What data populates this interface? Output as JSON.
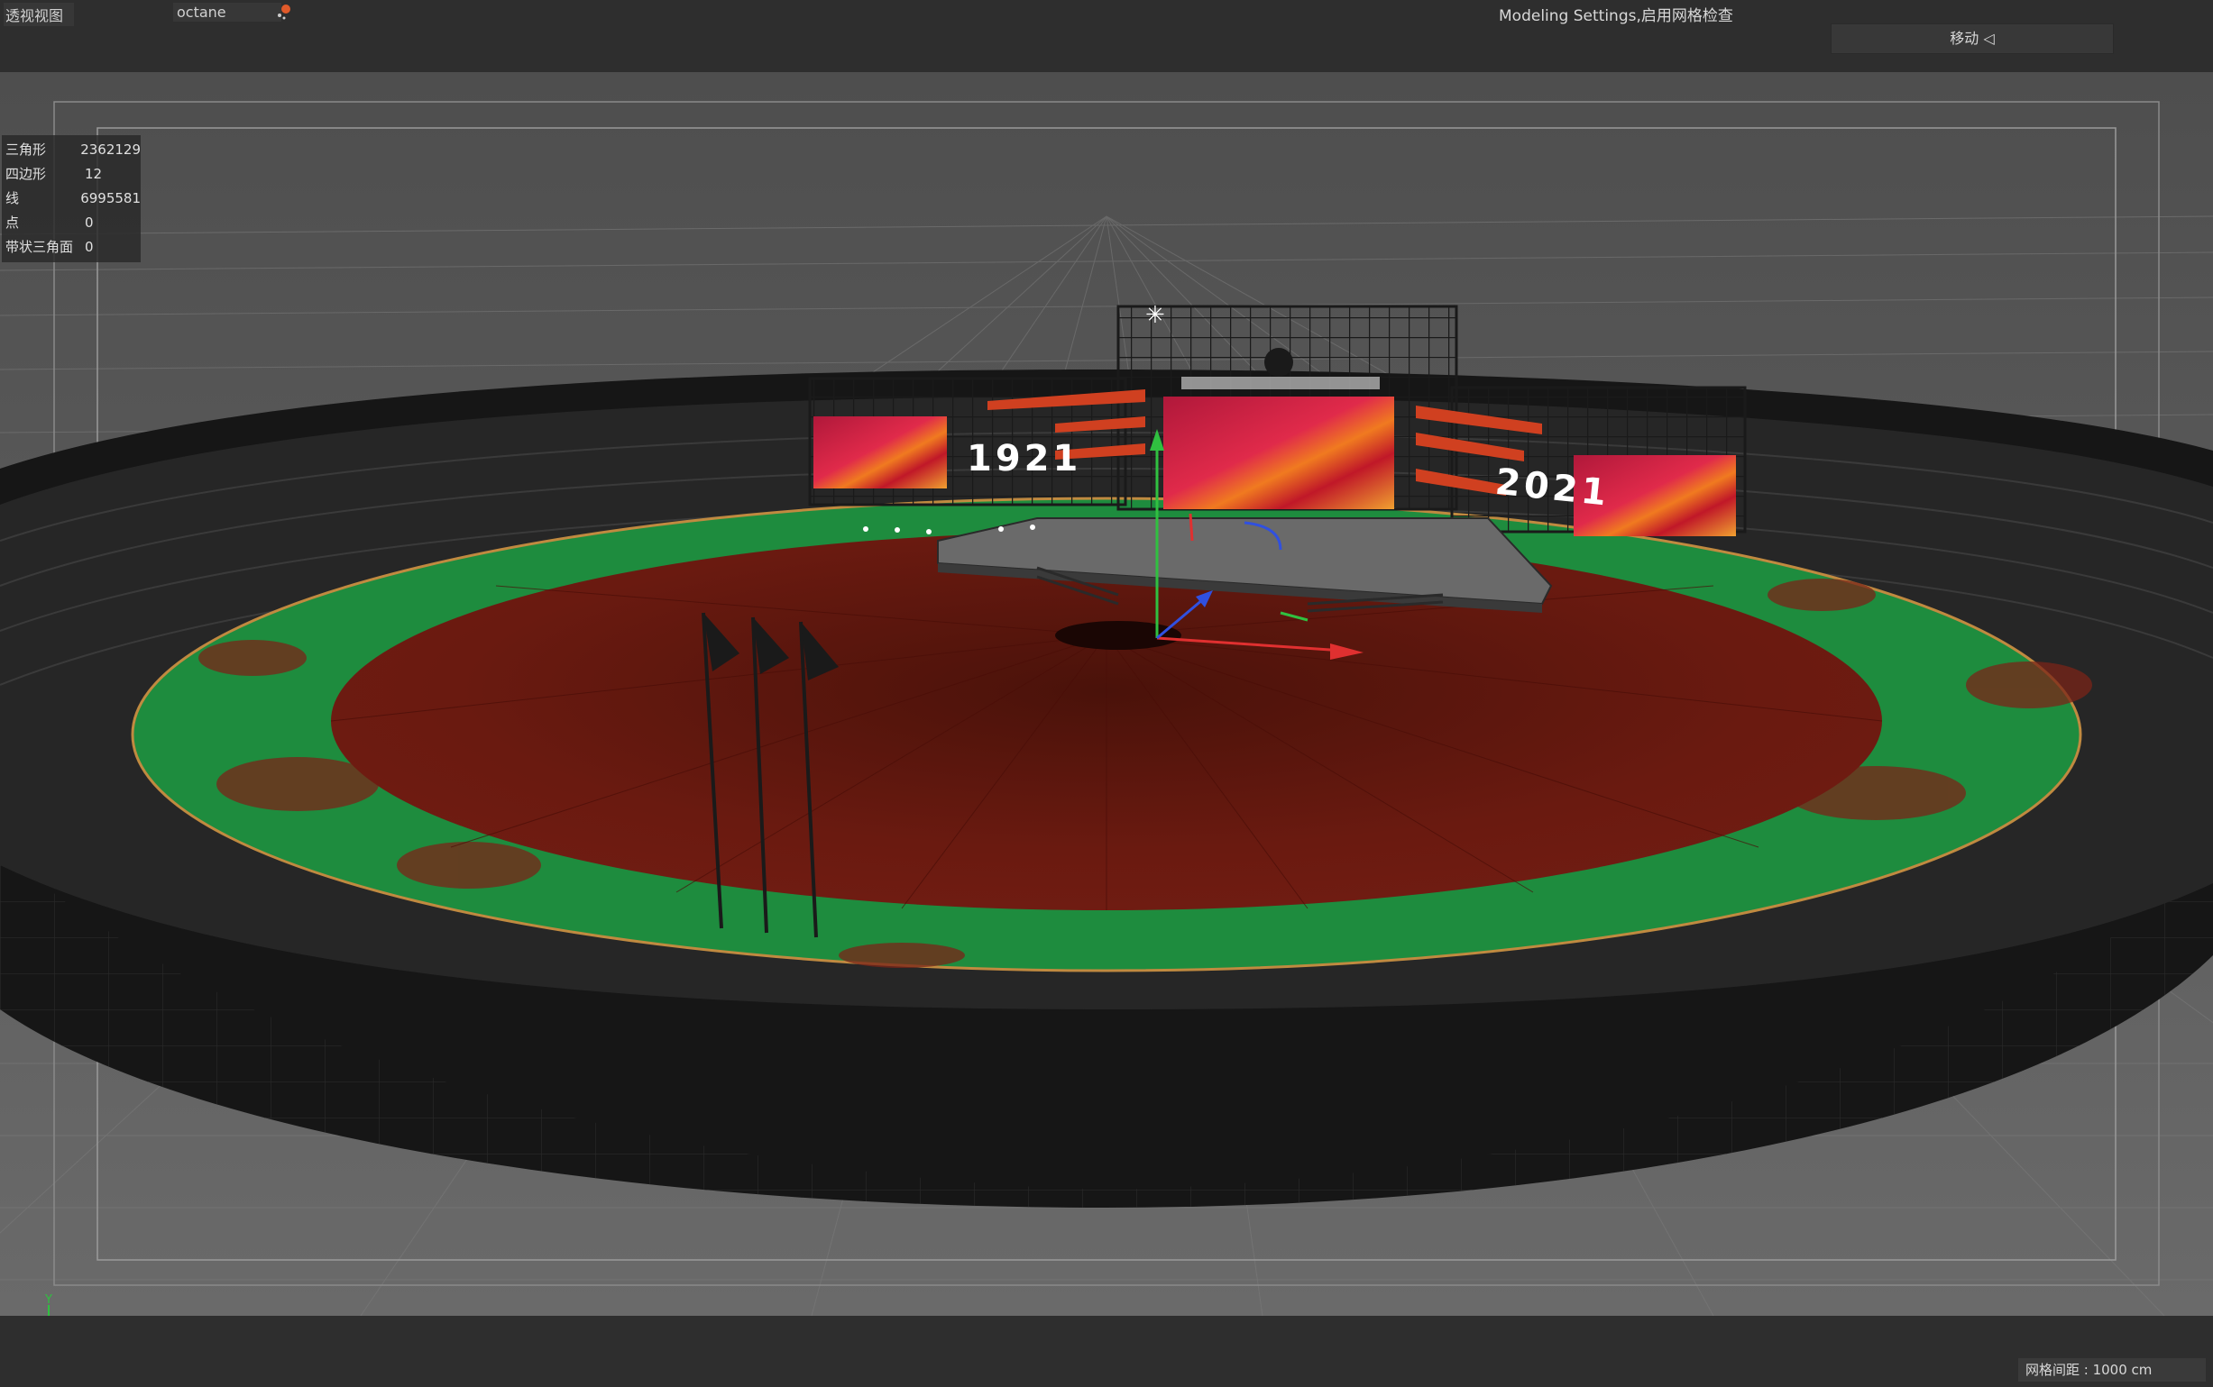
{
  "header": {
    "view_label": "透视视图",
    "renderer": "octane",
    "mode_title": "Modeling Settings,启用网格检查",
    "move_label": "移动 ◁"
  },
  "stats": [
    {
      "label": "三角形",
      "value": "2362129"
    },
    {
      "label": "四边形",
      "value": "12"
    },
    {
      "label": "线",
      "value": "6995581"
    },
    {
      "label": "点",
      "value": "0"
    },
    {
      "label": "带状三角面",
      "value": "0"
    }
  ],
  "scene": {
    "screen_left_text": "1921",
    "screen_right_text": "2021"
  },
  "axis": {
    "y": "Y",
    "z": "Z",
    "x": "X"
  },
  "footer": {
    "grid_spacing": "网格间距 : 1000 cm"
  },
  "colors": {
    "field_green": "#1e8c3e",
    "field_red": "#6a1a10",
    "axis_x": "#e03030",
    "axis_y": "#30c040",
    "axis_z": "#3050e0"
  }
}
